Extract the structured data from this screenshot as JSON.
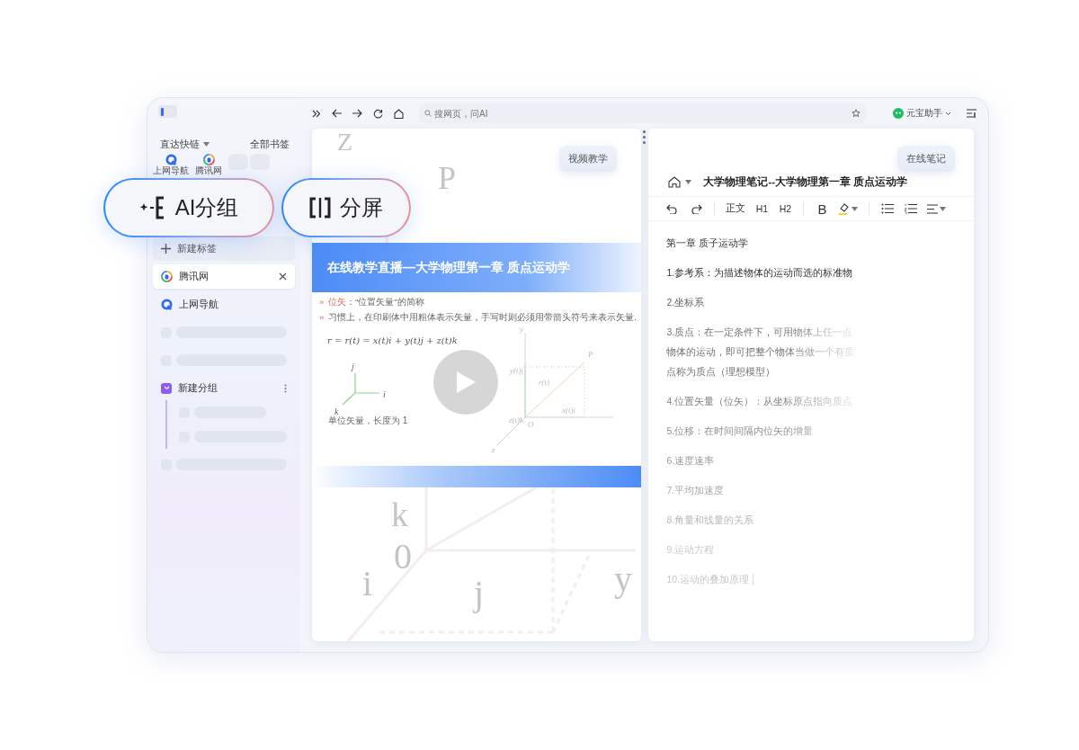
{
  "sidebar": {
    "quick_links_title": "直达快链",
    "all_bookmarks": "全部书签",
    "quick_links": [
      {
        "kind": "q",
        "label": "上网导航"
      },
      {
        "kind": "ring",
        "label": "腾讯网"
      },
      {
        "kind": "blank"
      },
      {
        "kind": "blank"
      }
    ],
    "tabs": [
      {
        "kind": "new",
        "label": "新建标签"
      },
      {
        "kind": "ring",
        "label": "腾讯网",
        "selected": true
      },
      {
        "kind": "q",
        "label": "上网导航",
        "selected": false
      },
      {
        "kind": "skeleton"
      },
      {
        "kind": "skeleton"
      },
      {
        "kind": "group",
        "label": "新建分组",
        "expanded": true,
        "children": [
          {
            "kind": "skeleton"
          },
          {
            "kind": "skeleton"
          }
        ]
      },
      {
        "kind": "skeleton"
      }
    ]
  },
  "toolbar": {
    "search": {
      "placeholder": "搜网页，问AI"
    },
    "assistant": "元宝助手"
  },
  "feature_pills": [
    {
      "kind": "ai-group",
      "label": "AI分组"
    },
    {
      "kind": "split",
      "label": "分屏"
    }
  ],
  "left_pane": {
    "badge": "视频教学",
    "backdrop_labels": [
      "Z",
      "P",
      "k",
      "0",
      "i",
      "j",
      "y"
    ],
    "slide": {
      "title": "在线教学直播—大学物理第一章 质点运动学",
      "bullets": [
        {
          "marker": "»",
          "term": "位矢",
          "text": "：“位置矢量”的简称"
        },
        {
          "marker": "»",
          "text": "习惯上，在印刷体中用粗体表示矢量，手写时则必须用带箭头符号来表示矢量."
        }
      ],
      "formula": "r = r(t) = x(t)i + y(t)j + z(t)k",
      "unit_labels": [
        "j",
        "i",
        "k"
      ],
      "unit_caption": "单位矢量，长度为 1",
      "diagram_labels": [
        "y",
        "P",
        "y(t)j",
        "r(t)",
        "x(t)i",
        "z(t)k",
        "O",
        "z"
      ]
    }
  },
  "right_pane": {
    "badge": "在线笔记",
    "doc_title": "大学物理笔记--大学物理第一章 质点运动学",
    "tools": [
      {
        "kind": "undo"
      },
      {
        "kind": "redo"
      },
      {
        "kind": "separator"
      },
      {
        "kind": "text",
        "label": "正文"
      },
      {
        "kind": "text",
        "label": "H1"
      },
      {
        "kind": "text",
        "label": "H2"
      },
      {
        "kind": "separator"
      },
      {
        "kind": "text",
        "label": "B"
      },
      {
        "kind": "highlight"
      },
      {
        "kind": "separator"
      },
      {
        "kind": "bullets"
      },
      {
        "kind": "numbered"
      },
      {
        "kind": "align"
      }
    ],
    "notes": [
      {
        "lines": [
          "第一章 质子运动学"
        ]
      },
      {
        "lines": [
          "1.参考系：为描述物体的运动而选的标准物"
        ]
      },
      {
        "lines": [
          "2.坐标系"
        ]
      },
      {
        "lines": [
          "3.质点：在一定条件下，可用物体上任一点",
          "物体的运动，即可把整个物体当做一个有质",
          "点称为质点（理想模型）"
        ]
      },
      {
        "lines": [
          "4.位置矢量（位矢）：从坐标原点指向质点"
        ]
      },
      {
        "lines": [
          "5.位移：在时间间隔内位矢的增量"
        ]
      },
      {
        "lines": [
          "6.速度速率"
        ]
      },
      {
        "lines": [
          "7.平均加速度"
        ]
      },
      {
        "lines": [
          "8.角量和线量的关系"
        ]
      },
      {
        "lines": [
          "9.运动方程"
        ]
      },
      {
        "lines": [
          "10.运动的叠加原理"
        ],
        "cursor": true
      }
    ]
  }
}
